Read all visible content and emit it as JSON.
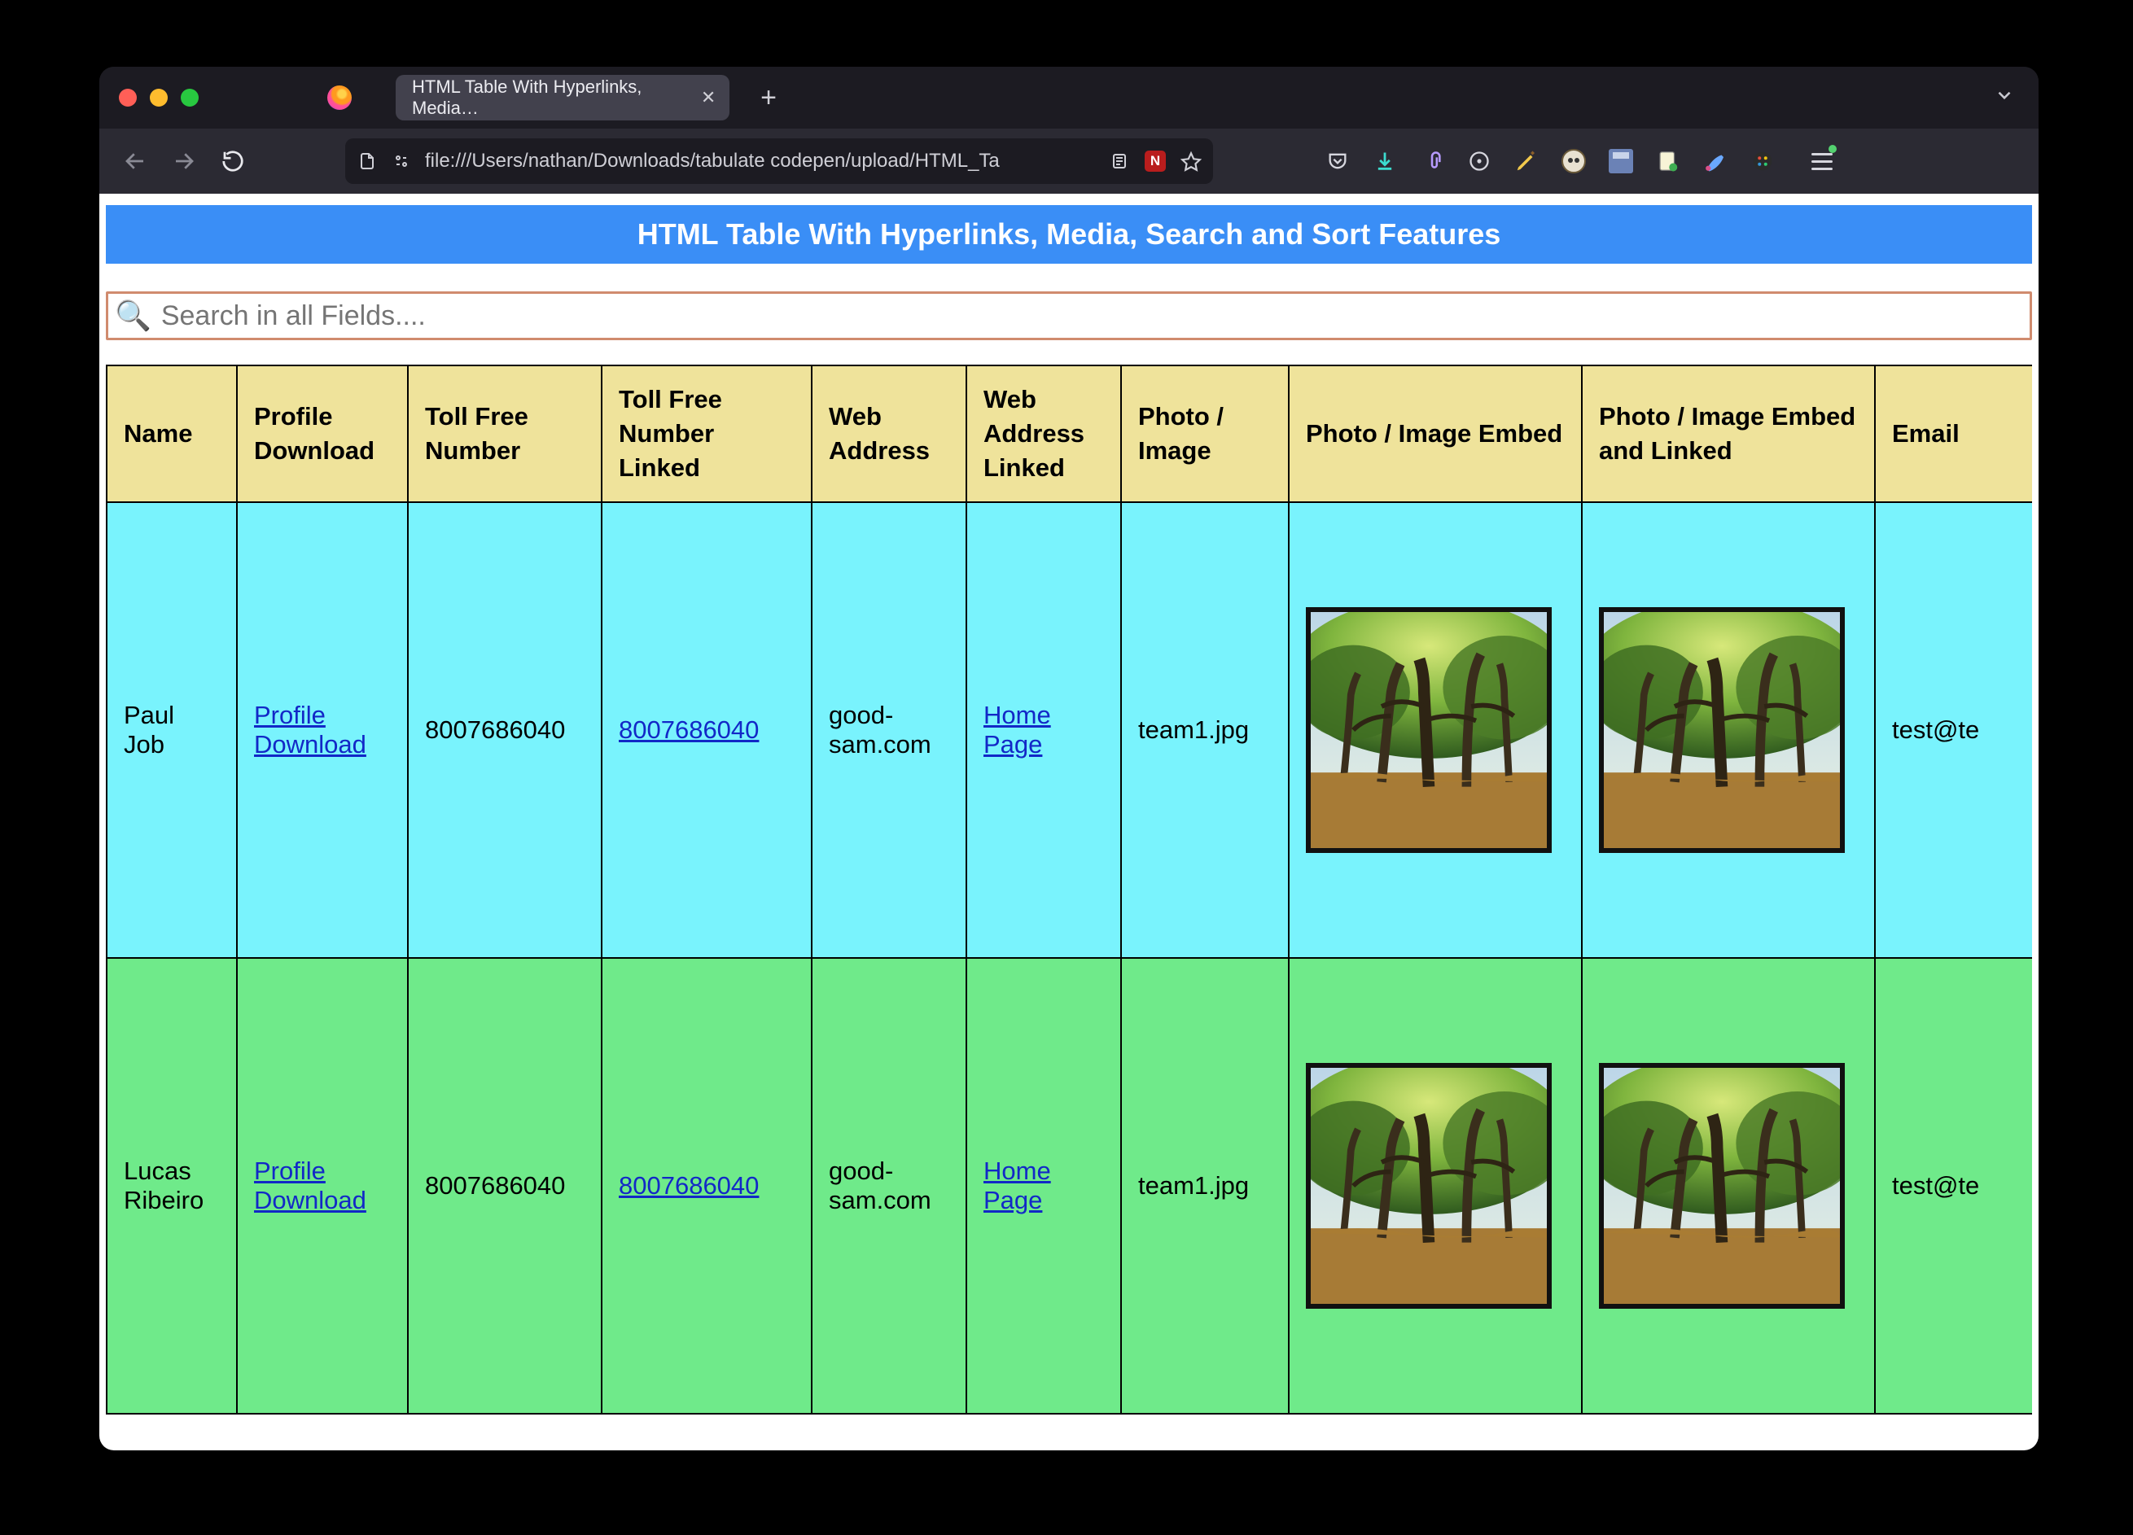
{
  "browser": {
    "tab_title": "HTML Table With Hyperlinks, Media…",
    "url": "file:///Users/nathan/Downloads/tabulate codepen/upload/HTML_Ta"
  },
  "page": {
    "title": "HTML Table With Hyperlinks, Media, Search and Sort Features",
    "search_placeholder": "Search in all Fields...."
  },
  "columns": [
    "Name",
    "Profile Download",
    "Toll Free Number",
    "Toll Free Number Linked",
    "Web Address",
    "Web Address Linked",
    "Photo / Image",
    "Photo / Image Embed",
    "Photo / Image Embed and Linked",
    "Email"
  ],
  "rows": [
    {
      "name": "Paul Job",
      "profile_download": "Profile Download",
      "toll_free": "8007686040",
      "toll_free_linked": "8007686040",
      "web_address": "good-sam.com",
      "web_address_linked": "Home Page",
      "photo": "team1.jpg",
      "email": "test@te",
      "row_class": "row-cyan"
    },
    {
      "name": "Lucas Ribeiro",
      "profile_download": "Profile Download",
      "toll_free": "8007686040",
      "toll_free_linked": "8007686040",
      "web_address": "good-sam.com",
      "web_address_linked": "Home Page",
      "photo": "team1.jpg",
      "email": "test@te",
      "row_class": "row-green"
    }
  ]
}
